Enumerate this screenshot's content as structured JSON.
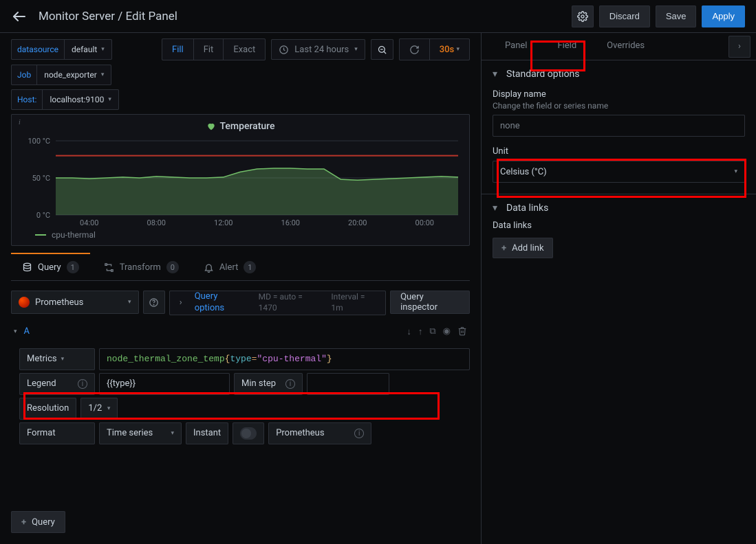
{
  "header": {
    "title": "Monitor Server / Edit Panel",
    "settings_tooltip": "Settings",
    "discard": "Discard",
    "save": "Save",
    "apply": "Apply"
  },
  "vars": {
    "datasource_label": "datasource",
    "datasource_value": "default",
    "job_label": "Job",
    "job_value": "node_exporter",
    "host_label": "Host:",
    "host_value": "localhost:9100"
  },
  "viewmodes": {
    "fill": "Fill",
    "fit": "Fit",
    "exact": "Exact"
  },
  "timepicker": {
    "range": "Last 24 hours",
    "refresh_interval": "30s"
  },
  "chart": {
    "title": "Temperature",
    "legend_item": "cpu-thermal"
  },
  "chart_data": {
    "type": "line",
    "title": "Temperature",
    "ylabel": "°C",
    "ylim": [
      0,
      100
    ],
    "yticks": [
      0,
      50,
      100
    ],
    "ytick_labels": [
      "0 °C",
      "50 °C",
      "100 °C"
    ],
    "xticks": [
      "04:00",
      "08:00",
      "12:00",
      "16:00",
      "20:00",
      "00:00"
    ],
    "threshold": 80,
    "series": [
      {
        "name": "cpu-thermal",
        "color": "#73bf69",
        "values": [
          50,
          50,
          49,
          50,
          51,
          50,
          52,
          51,
          50,
          50,
          51,
          58,
          62,
          63,
          63,
          62,
          62,
          48,
          47,
          48,
          49,
          50,
          51,
          52,
          51
        ]
      }
    ]
  },
  "query_tabs": {
    "query": "Query",
    "query_count": "1",
    "transform": "Transform",
    "transform_count": "0",
    "alert": "Alert",
    "alert_count": "1"
  },
  "query_editor": {
    "datasource": "Prometheus",
    "query_options_label": "Query options",
    "md_line": "MD = auto = 1470",
    "interval_line": "Interval = 1m",
    "query_inspector": "Query inspector",
    "row_name": "A",
    "metrics_label": "Metrics",
    "metrics_parts": {
      "metric": "node_thermal_zone_temp",
      "brace_open": "{",
      "key": "type",
      "eq": "=",
      "val": "\"cpu-thermal\"",
      "brace_close": "}"
    },
    "legend_label": "Legend",
    "legend_value": "{{type}}",
    "minstep_label": "Min step",
    "resolution_label": "Resolution",
    "resolution_value": "1/2",
    "format_label": "Format",
    "format_value": "Time series",
    "instant_label": "Instant",
    "prometheus_label": "Prometheus",
    "add_query": "Query"
  },
  "right": {
    "tabs": {
      "panel": "Panel",
      "field": "Field",
      "overrides": "Overrides"
    },
    "standard_options": {
      "title": "Standard options",
      "display_name_label": "Display name",
      "display_name_sub": "Change the field or series name",
      "display_name_placeholder": "none",
      "unit_label": "Unit",
      "unit_value": "Celsius (°C)"
    },
    "data_links": {
      "title": "Data links",
      "sub": "Data links",
      "add_link": "Add link"
    }
  }
}
